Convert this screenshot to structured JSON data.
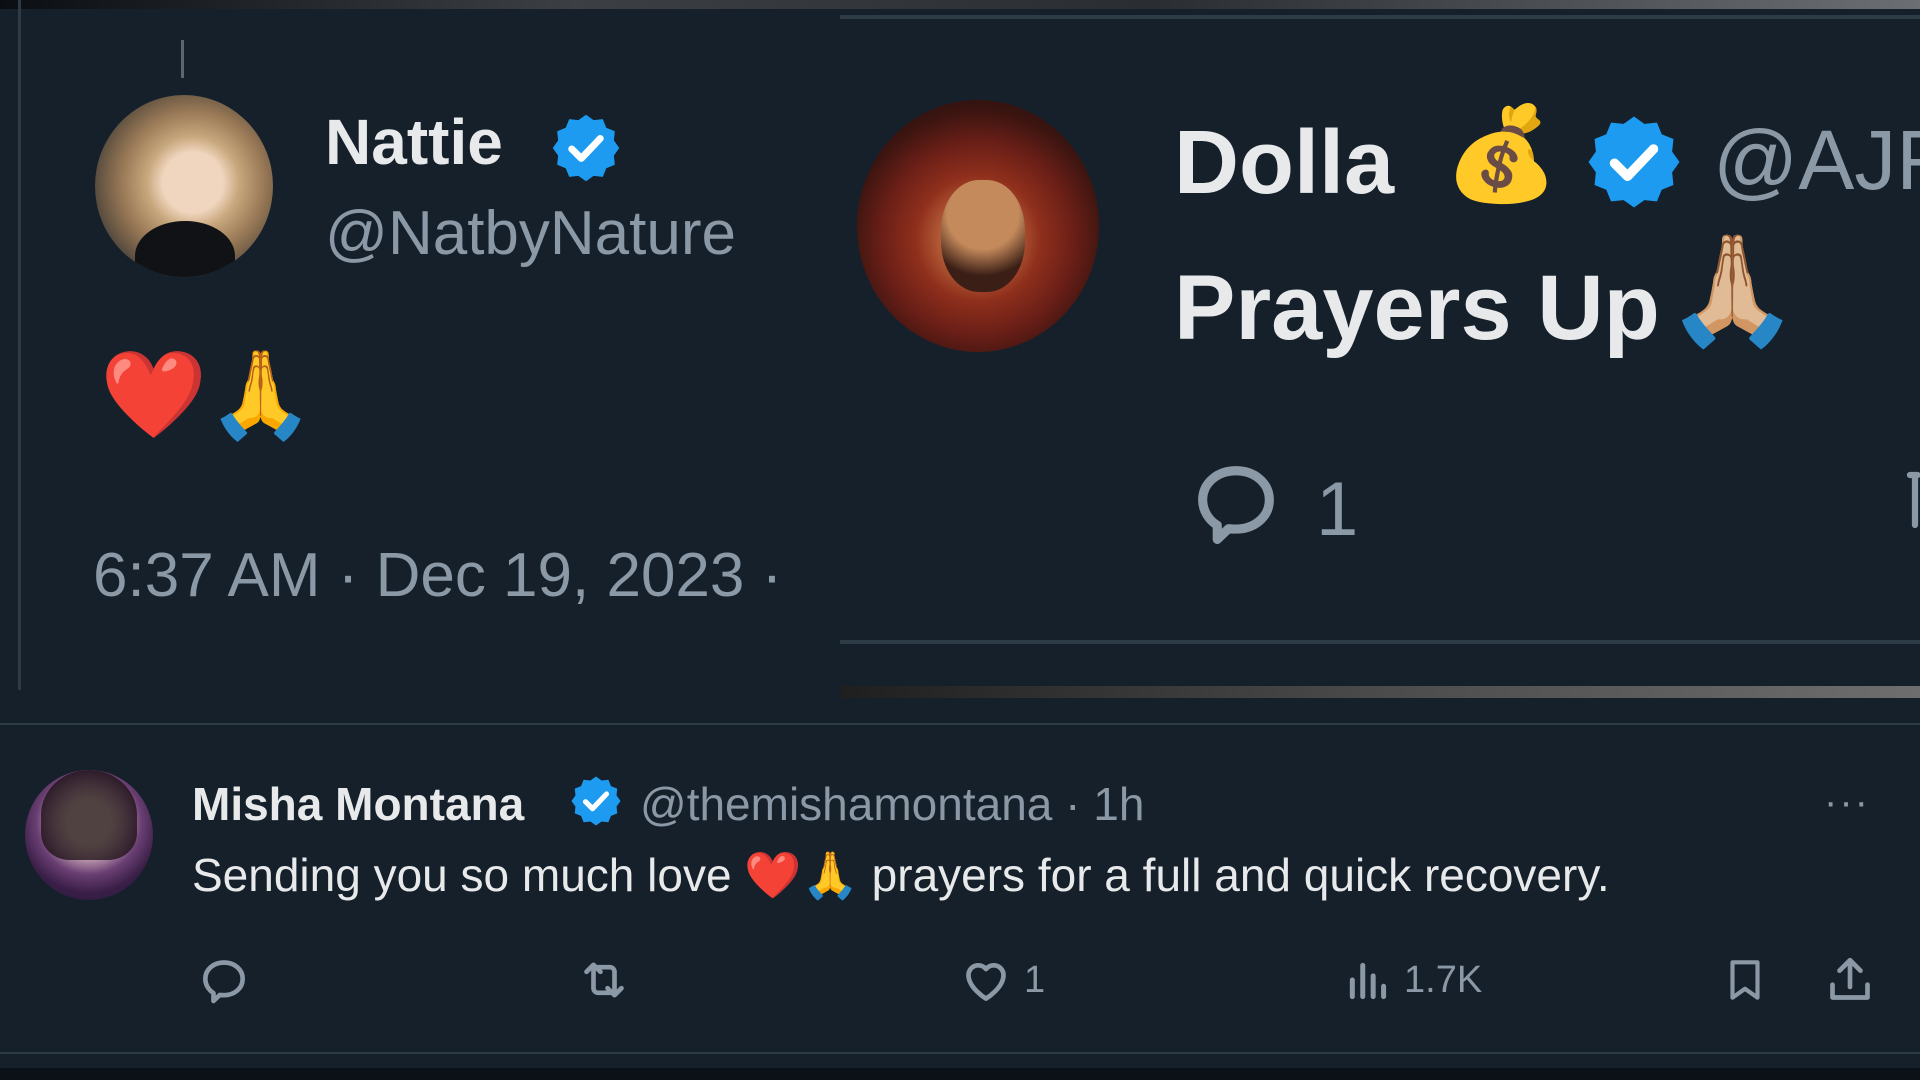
{
  "tweets": {
    "nattie": {
      "display_name": "Nattie",
      "handle": "@NatbyNature",
      "content_emoji": "❤️🙏",
      "timestamp": "6:37 AM · Dec 19, 2023 ·"
    },
    "dolla": {
      "display_name": "Dolla",
      "name_emoji": "💰",
      "handle_partial": "@AJF",
      "text": "Prayers Up",
      "text_emoji": "🙏🏼",
      "reply_count": "1"
    },
    "misha": {
      "display_name": "Misha Montana",
      "handle_time": "@themishamontana · 1h",
      "more_label": "···",
      "text": "Sending you so much love ❤️🙏 prayers for a full and quick recovery.",
      "actions": {
        "like_count": "1",
        "views_count": "1.7K"
      }
    }
  },
  "colors": {
    "background": "#15202b",
    "primary_text": "#e7e9ea",
    "secondary_text": "#8b98a5",
    "verified_blue": "#1d9bf0",
    "divider": "#2d3b47"
  },
  "icons": [
    "verified-badge-icon",
    "reply-icon",
    "retweet-icon",
    "like-icon",
    "views-icon",
    "bookmark-icon",
    "share-icon",
    "more-options-icon"
  ]
}
